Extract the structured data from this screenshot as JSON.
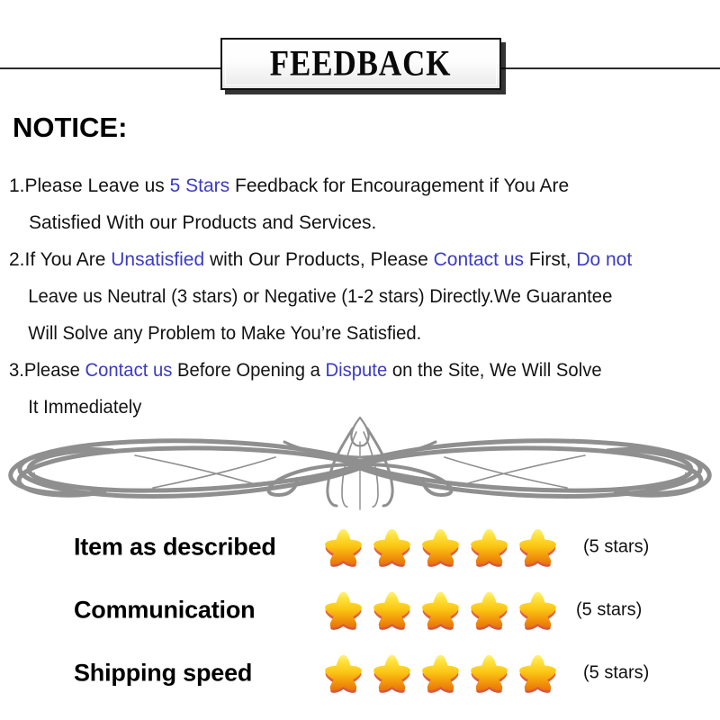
{
  "banner": {
    "title": "FEEDBACK"
  },
  "notice": {
    "heading": "NOTICE",
    "heading_colon": ":",
    "lines": [
      {
        "indent": false,
        "condensed": false,
        "parts": [
          {
            "text": "1.Please Leave us  ",
            "color": "black"
          },
          {
            "text": "5 Stars",
            "color": "blue"
          },
          {
            "text": "  Feedback for  Encouragement  if You Are",
            "color": "black"
          }
        ]
      },
      {
        "indent": true,
        "condensed": false,
        "parts": [
          {
            "text": "Satisfied With our Products and Services.",
            "color": "black"
          }
        ]
      },
      {
        "indent": false,
        "condensed": false,
        "parts": [
          {
            "text": "2.If You Are ",
            "color": "black"
          },
          {
            "text": "Unsatisfied",
            "color": "blue"
          },
          {
            "text": " with Our Products, Please ",
            "color": "black"
          },
          {
            "text": "Contact us",
            "color": "blue"
          },
          {
            "text": " First, ",
            "color": "black"
          },
          {
            "text": "Do not",
            "color": "blue"
          }
        ]
      },
      {
        "indent": true,
        "condensed": true,
        "parts": [
          {
            "text": "Leave us Neutral (3 stars) or Negative (1-2 stars) Directly.We Guarantee",
            "color": "black"
          }
        ]
      },
      {
        "indent": true,
        "condensed": true,
        "parts": [
          {
            "text": "Will Solve any Problem to Make You’re  Satisfied.",
            "color": "black"
          }
        ]
      },
      {
        "indent": false,
        "condensed": true,
        "parts": [
          {
            "text": "3.Please ",
            "color": "black"
          },
          {
            "text": "Contact us",
            "color": "blue"
          },
          {
            "text": " Before Opening a ",
            "color": "black"
          },
          {
            "text": "Dispute",
            "color": "blue"
          },
          {
            "text": " on the Site, We Will Solve",
            "color": "black"
          }
        ]
      },
      {
        "indent": true,
        "condensed": true,
        "parts": [
          {
            "text": "It Immediately",
            "color": "black"
          }
        ]
      }
    ]
  },
  "divider": {
    "icon": "ornamental-flourish-divider",
    "color": "#8f8f8f"
  },
  "ratings": [
    {
      "label": "Item as described",
      "stars": 5,
      "count_text": "(5 stars)"
    },
    {
      "label": "Communication",
      "stars": 5,
      "count_text": "(5 stars)"
    },
    {
      "label": "Shipping speed",
      "stars": 5,
      "count_text": "(5 stars)"
    }
  ],
  "colors": {
    "blue_text": "#3b3bc4",
    "star_top": "#ffe94a",
    "star_mid": "#fcc517",
    "star_bottom": "#ef8a0c",
    "star_shadow": "#d9452a",
    "ornament_gray": "#8f8f8f"
  }
}
